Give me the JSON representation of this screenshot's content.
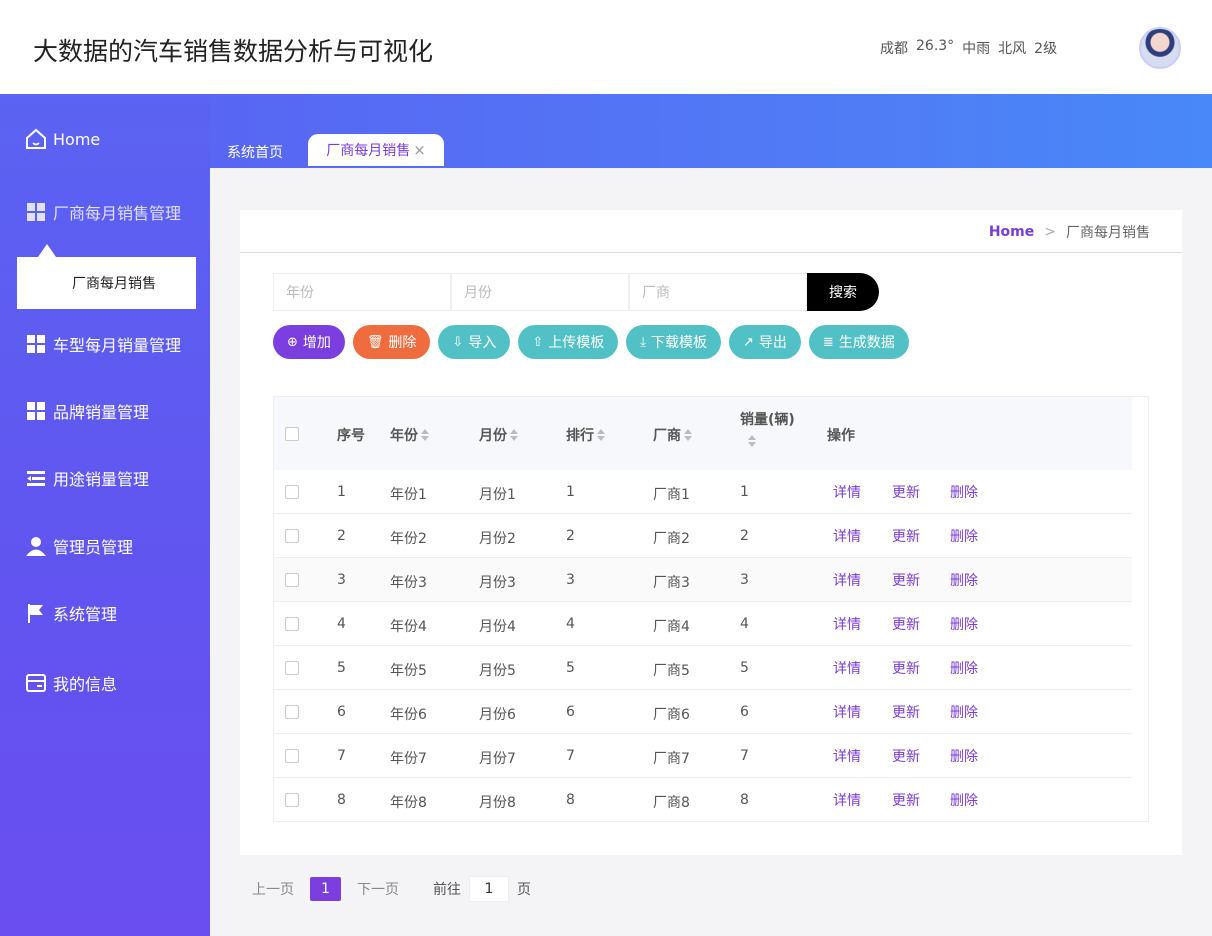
{
  "header": {
    "title": "大数据的汽车销售数据分析与可视化",
    "weather": [
      "成都",
      "26.3°",
      "中雨",
      "北风",
      "2级"
    ]
  },
  "sidebar": {
    "items": [
      {
        "label": "Home",
        "icon": "home-icon"
      },
      {
        "label": "厂商每月销售管理",
        "icon": "grid-icon"
      },
      {
        "label": "车型每月销量管理",
        "icon": "grid-icon"
      },
      {
        "label": "品牌销量管理",
        "icon": "grid-icon"
      },
      {
        "label": "用途销量管理",
        "icon": "list-icon"
      },
      {
        "label": "管理员管理",
        "icon": "user-icon"
      },
      {
        "label": "系统管理",
        "icon": "flag-icon"
      },
      {
        "label": "我的信息",
        "icon": "card-icon"
      }
    ],
    "sub_item": "厂商每月销售"
  },
  "tabs": {
    "home": "系统首页",
    "active": "厂商每月销售"
  },
  "breadcrumb": {
    "home": "Home",
    "separator": ">",
    "current": "厂商每月销售"
  },
  "search": {
    "year_placeholder": "年份",
    "month_placeholder": "月份",
    "maker_placeholder": "厂商",
    "button": "搜索"
  },
  "actions": {
    "add": "增加",
    "delete": "删除",
    "import": "导入",
    "upload_template": "上传模板",
    "download_template": "下载模板",
    "export": "导出",
    "generate": "生成数据"
  },
  "table": {
    "headers": {
      "index": "序号",
      "year": "年份",
      "month": "月份",
      "rank": "排行",
      "maker": "厂商",
      "sales": "销量(辆)",
      "ops": "操作"
    },
    "op_labels": {
      "detail": "详情",
      "update": "更新",
      "delete": "删除"
    },
    "rows": [
      {
        "index": "1",
        "year": "年份1",
        "month": "月份1",
        "rank": "1",
        "maker": "厂商1",
        "sales": "1"
      },
      {
        "index": "2",
        "year": "年份2",
        "month": "月份2",
        "rank": "2",
        "maker": "厂商2",
        "sales": "2"
      },
      {
        "index": "3",
        "year": "年份3",
        "month": "月份3",
        "rank": "3",
        "maker": "厂商3",
        "sales": "3"
      },
      {
        "index": "4",
        "year": "年份4",
        "month": "月份4",
        "rank": "4",
        "maker": "厂商4",
        "sales": "4"
      },
      {
        "index": "5",
        "year": "年份5",
        "month": "月份5",
        "rank": "5",
        "maker": "厂商5",
        "sales": "5"
      },
      {
        "index": "6",
        "year": "年份6",
        "month": "月份6",
        "rank": "6",
        "maker": "厂商6",
        "sales": "6"
      },
      {
        "index": "7",
        "year": "年份7",
        "month": "月份7",
        "rank": "7",
        "maker": "厂商7",
        "sales": "7"
      },
      {
        "index": "8",
        "year": "年份8",
        "month": "月份8",
        "rank": "8",
        "maker": "厂商8",
        "sales": "8"
      }
    ]
  },
  "pagination": {
    "prev": "上一页",
    "current": "1",
    "next": "下一页",
    "goto": "前往",
    "page_value": "1",
    "page_unit": "页"
  },
  "colors": {
    "accent": "#7b3fe0",
    "danger": "#ee6c3e",
    "teal": "#52c1c6",
    "sidebar": "#5b63f2"
  }
}
